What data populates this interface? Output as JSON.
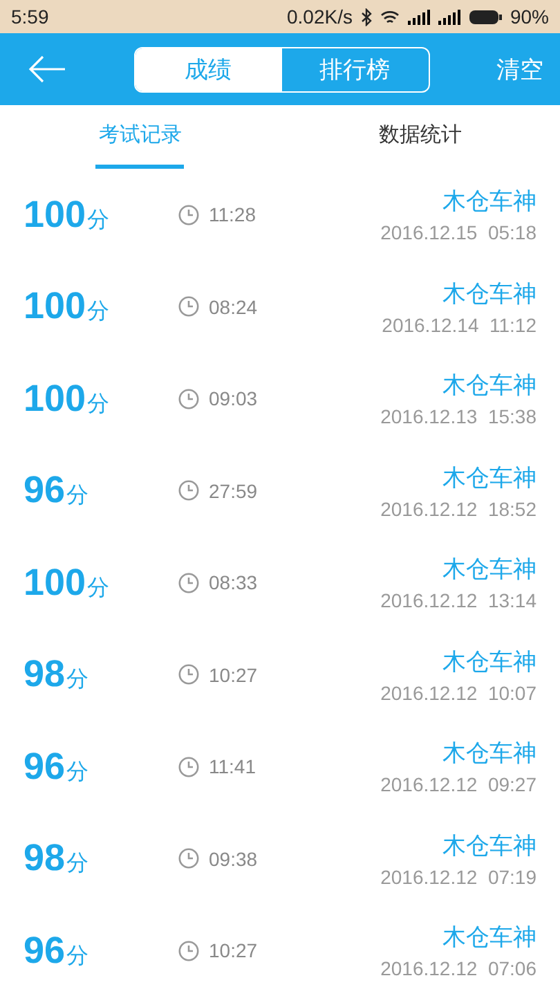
{
  "status_bar": {
    "time": "5:59",
    "speed": "0.02K/s",
    "battery": "90%"
  },
  "header": {
    "segments": [
      {
        "label": "成绩",
        "selected": true
      },
      {
        "label": "排行榜",
        "selected": false
      }
    ],
    "action": "清空"
  },
  "tabs": [
    {
      "label": "考试记录",
      "selected": true
    },
    {
      "label": "数据统计",
      "selected": false
    }
  ],
  "records": [
    {
      "score": "100",
      "unit": "分",
      "duration": "11:28",
      "name": "木仓车神",
      "date": "2016.12.15  05:18"
    },
    {
      "score": "100",
      "unit": "分",
      "duration": "08:24",
      "name": "木仓车神",
      "date": "2016.12.14  11:12"
    },
    {
      "score": "100",
      "unit": "分",
      "duration": "09:03",
      "name": "木仓车神",
      "date": "2016.12.13  15:38"
    },
    {
      "score": "96",
      "unit": "分",
      "duration": "27:59",
      "name": "木仓车神",
      "date": "2016.12.12  18:52"
    },
    {
      "score": "100",
      "unit": "分",
      "duration": "08:33",
      "name": "木仓车神",
      "date": "2016.12.12  13:14"
    },
    {
      "score": "98",
      "unit": "分",
      "duration": "10:27",
      "name": "木仓车神",
      "date": "2016.12.12  10:07"
    },
    {
      "score": "96",
      "unit": "分",
      "duration": "11:41",
      "name": "木仓车神",
      "date": "2016.12.12  09:27"
    },
    {
      "score": "98",
      "unit": "分",
      "duration": "09:38",
      "name": "木仓车神",
      "date": "2016.12.12  07:19"
    },
    {
      "score": "96",
      "unit": "分",
      "duration": "10:27",
      "name": "木仓车神",
      "date": "2016.12.12  07:06"
    }
  ]
}
